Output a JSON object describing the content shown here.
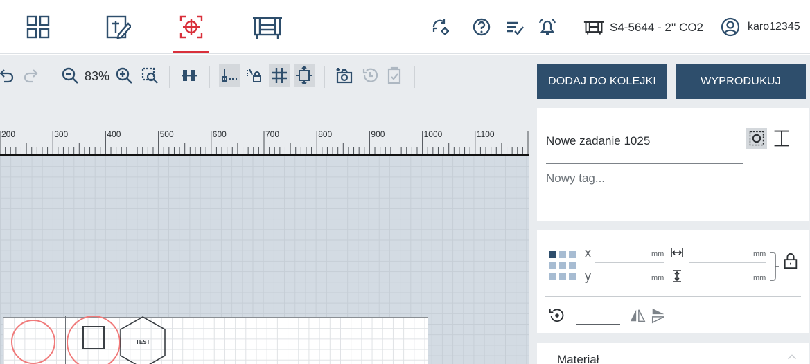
{
  "nav": {
    "tabs": [
      {
        "name": "dashboard",
        "icon": "grid-icon"
      },
      {
        "name": "design",
        "icon": "edit-icon"
      },
      {
        "name": "workspace",
        "icon": "target-icon",
        "active": true
      },
      {
        "name": "machines",
        "icon": "machine-icon"
      }
    ],
    "tools": [
      "sync-settings-icon",
      "help-icon",
      "queue-list-icon",
      "notification-bell-icon"
    ],
    "machine": "S4-5644 - 2'' CO2",
    "user": "karo12345"
  },
  "toolbar": {
    "zoom": "83%"
  },
  "ruler": {
    "labels": [
      "200",
      "300",
      "400",
      "500",
      "600",
      "700",
      "800",
      "900",
      "1000",
      "1100"
    ]
  },
  "canvas": {
    "hexagon_text": "TEST"
  },
  "panel": {
    "add_to_queue": "DODAJ DO KOLEJKI",
    "produce": "WYPRODUKUJ",
    "job_name": "Nowe zadanie 1025",
    "tag_placeholder": "Nowy tag...",
    "x_label": "x",
    "y_label": "y",
    "unit": "mm",
    "material_title": "Materiał"
  },
  "colors": {
    "accent": "#d9303b",
    "primary": "#2e4e6c",
    "canvas_bg": "#d3dbe3"
  }
}
